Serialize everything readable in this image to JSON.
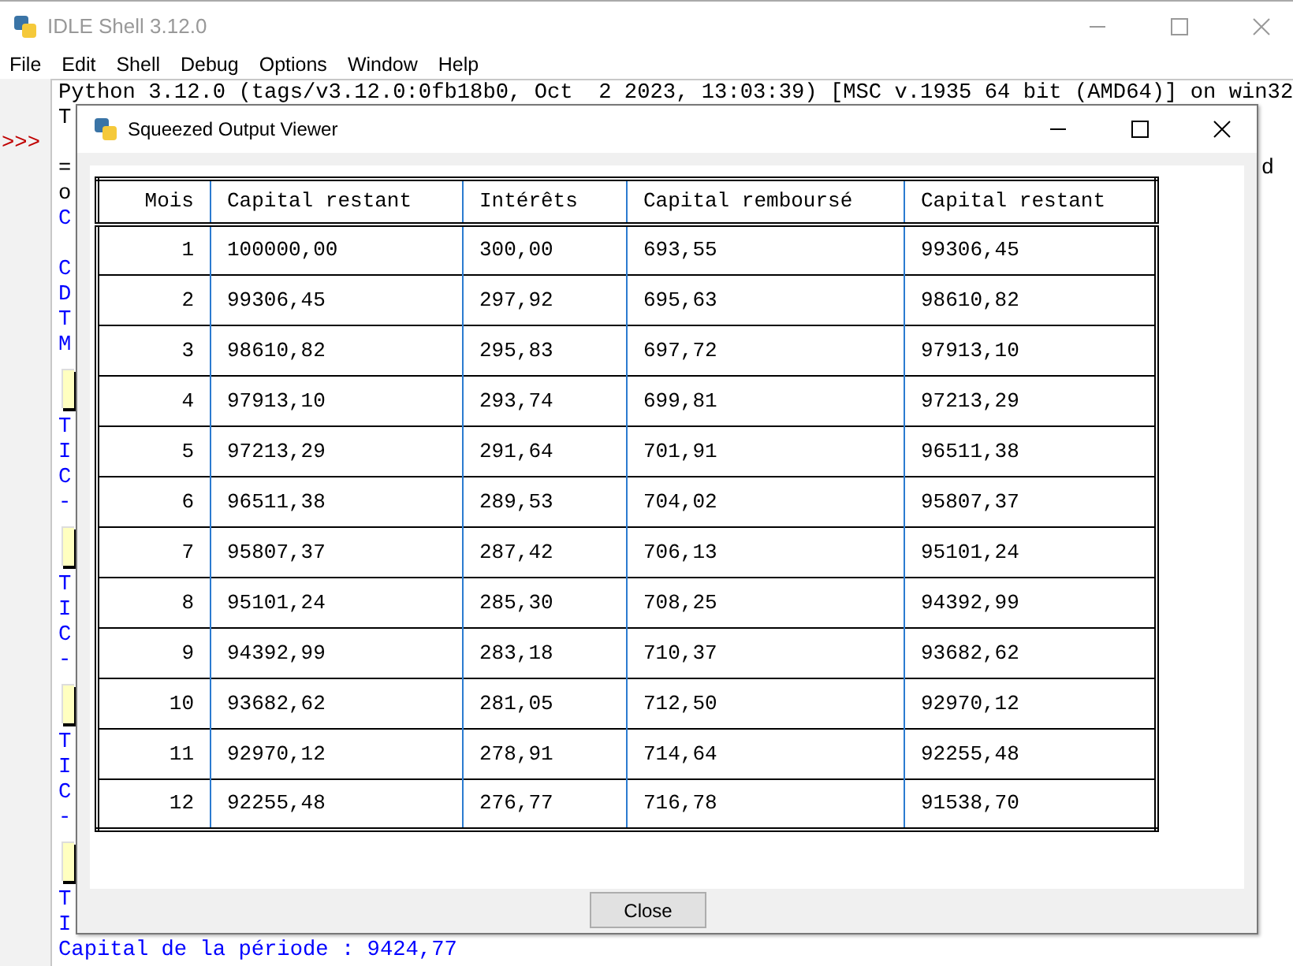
{
  "window": {
    "title": "IDLE Shell 3.12.0"
  },
  "menu": [
    "File",
    "Edit",
    "Shell",
    "Debug",
    "Options",
    "Window",
    "Help"
  ],
  "shell": {
    "lines": [
      {
        "kind": "text",
        "text": "Python 3.12.0 (tags/v3.12.0:0fb18b0, Oct  2 2023, 13:03:39) [MSC v.1935 64 bit (AMD64)] on win32",
        "color": "#000000"
      },
      {
        "kind": "text",
        "text": "T",
        "color": "#000000"
      },
      {
        "kind": "prompt",
        "prompt": ">>>"
      },
      {
        "kind": "text",
        "text": "=",
        "tail": "d",
        "color": "#000000"
      },
      {
        "kind": "text",
        "text": "o",
        "color": "#000000"
      },
      {
        "kind": "text",
        "text": "C",
        "color": "#0000ff"
      },
      {
        "kind": "blank"
      },
      {
        "kind": "text",
        "text": "C",
        "color": "#0000ff"
      },
      {
        "kind": "text",
        "text": "D",
        "color": "#0000ff"
      },
      {
        "kind": "text",
        "text": "T",
        "color": "#0000ff"
      },
      {
        "kind": "text",
        "text": "M",
        "color": "#0000ff"
      },
      {
        "kind": "squeezed"
      },
      {
        "kind": "text",
        "text": "T",
        "color": "#0000ff"
      },
      {
        "kind": "text",
        "text": "I",
        "color": "#0000ff"
      },
      {
        "kind": "text",
        "text": "C",
        "color": "#0000ff"
      },
      {
        "kind": "text",
        "text": "-",
        "color": "#0000ff"
      },
      {
        "kind": "squeezed"
      },
      {
        "kind": "text",
        "text": "T",
        "color": "#0000ff"
      },
      {
        "kind": "text",
        "text": "I",
        "color": "#0000ff"
      },
      {
        "kind": "text",
        "text": "C",
        "color": "#0000ff"
      },
      {
        "kind": "text",
        "text": "-",
        "color": "#0000ff"
      },
      {
        "kind": "squeezed"
      },
      {
        "kind": "text",
        "text": "T",
        "color": "#0000ff"
      },
      {
        "kind": "text",
        "text": "I",
        "color": "#0000ff"
      },
      {
        "kind": "text",
        "text": "C",
        "color": "#0000ff"
      },
      {
        "kind": "text",
        "text": "-",
        "color": "#0000ff"
      },
      {
        "kind": "squeezed"
      },
      {
        "kind": "text",
        "text": "T",
        "color": "#0000ff"
      },
      {
        "kind": "text",
        "text": "I",
        "color": "#0000ff"
      },
      {
        "kind": "text",
        "text": "Capital de la période : 9424,77",
        "color": "#0000ff"
      }
    ]
  },
  "dialog": {
    "title": "Squeezed Output Viewer",
    "table": {
      "columns": [
        "Mois",
        "Capital restant",
        "Intérêts",
        "Capital remboursé",
        "Capital restant"
      ],
      "rows": [
        [
          "1",
          "100000,00",
          "300,00",
          "693,55",
          "99306,45"
        ],
        [
          "2",
          "99306,45",
          "297,92",
          "695,63",
          "98610,82"
        ],
        [
          "3",
          "98610,82",
          "295,83",
          "697,72",
          "97913,10"
        ],
        [
          "4",
          "97913,10",
          "293,74",
          "699,81",
          "97213,29"
        ],
        [
          "5",
          "97213,29",
          "291,64",
          "701,91",
          "96511,38"
        ],
        [
          "6",
          "96511,38",
          "289,53",
          "704,02",
          "95807,37"
        ],
        [
          "7",
          "95807,37",
          "287,42",
          "706,13",
          "95101,24"
        ],
        [
          "8",
          "95101,24",
          "285,30",
          "708,25",
          "94392,99"
        ],
        [
          "9",
          "94392,99",
          "283,18",
          "710,37",
          "93682,62"
        ],
        [
          "10",
          "93682,62",
          "281,05",
          "712,50",
          "92970,12"
        ],
        [
          "11",
          "92970,12",
          "278,91",
          "714,64",
          "92255,48"
        ],
        [
          "12",
          "92255,48",
          "276,77",
          "716,78",
          "91538,70"
        ]
      ]
    },
    "button": "Close"
  }
}
